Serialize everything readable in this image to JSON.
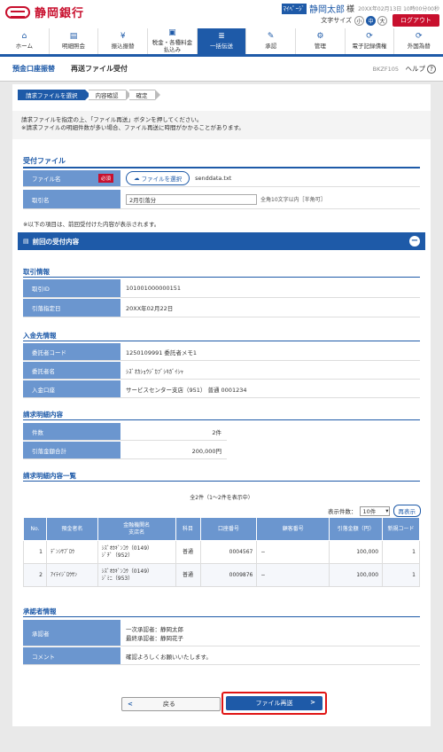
{
  "header": {
    "bank_name": "静岡銀行",
    "user_badge": "ﾏｲﾍﾟｰｼﾞ",
    "user_name": "静岡太郎",
    "user_suffix": "様",
    "last_login": "20XX年02月13日 10時00分00秒",
    "font_size_label": "文字サイズ",
    "font_sizes": [
      "小",
      "中",
      "大"
    ],
    "logout": "ログアウト"
  },
  "nav": [
    {
      "icon": "home-icon",
      "glyph": "⌂",
      "label": "ホーム"
    },
    {
      "icon": "statement-icon",
      "glyph": "▤",
      "label": "明細照会"
    },
    {
      "icon": "transfer-icon",
      "glyph": "¥",
      "label": "振込振替"
    },
    {
      "icon": "tax-icon",
      "glyph": "▣",
      "label": "税金・各種料金\n払込み"
    },
    {
      "icon": "bulk-icon",
      "glyph": "≣",
      "label": "一括伝送"
    },
    {
      "icon": "approval-icon",
      "glyph": "✎",
      "label": "承認"
    },
    {
      "icon": "admin-icon",
      "glyph": "⚙",
      "label": "管理"
    },
    {
      "icon": "e-record-icon",
      "glyph": "⟳",
      "label": "電子記録債権"
    },
    {
      "icon": "forex-icon",
      "glyph": "⟳",
      "label": "外国為替"
    }
  ],
  "title": {
    "category": "預金口座振替",
    "main": "再送ファイル受付",
    "screen_id": "BKZF105",
    "help": "ヘルプ"
  },
  "steps": [
    "請求ファイルを選択",
    "内容確認",
    "確定"
  ],
  "notice": {
    "line1": "請求ファイルを指定の上、「ファイル再送」ボタンを押してください。",
    "line2": "※請求ファイルの明細件数が多い場合、ファイル再送に時間がかかることがあります。"
  },
  "upload": {
    "section": "受付ファイル",
    "file_label": "ファイル名",
    "required": "必須",
    "choose_btn": "ファイルを選択",
    "file_name": "senddata.txt",
    "name_label": "取引名",
    "name_value": "2月引落分",
    "name_note": "全角10文字以内［半角可］"
  },
  "note_below": "※以下の項目は、前回受付けた内容が表示されます。",
  "prev": {
    "head": "前回の受付内容",
    "toggle": "−",
    "trade": {
      "title": "取引情報",
      "rows": [
        {
          "label": "取引ID",
          "value": "101001000000151"
        },
        {
          "label": "引落指定日",
          "value": "20XX年02月22日"
        }
      ]
    },
    "deposit": {
      "title": "入金先情報",
      "rows": [
        {
          "label": "委託者コード",
          "value": "1250109991 委託者メモ1"
        },
        {
          "label": "委託者名",
          "value": "ｼｽﾞｵｶｼｮｳｼﾞｶﾌﾞｼｷｶﾞｲｼｬ"
        },
        {
          "label": "入金口座",
          "value": "サービスセンター支店（951） 普通 0001234"
        }
      ]
    },
    "billing": {
      "title": "請求明細内容",
      "rows": [
        {
          "label": "件数",
          "value": "2件"
        },
        {
          "label": "引落金額合計",
          "value": "200,000円"
        }
      ]
    },
    "list": {
      "title": "請求明細内容一覧",
      "count_text": "全2件（1～2件を表示中）",
      "per_page_label": "表示件数：",
      "per_page_value": "10件",
      "redisplay": "再表示",
      "columns": [
        "No.",
        "預金者名",
        "金融機関名\n支店名",
        "科目",
        "口座番号",
        "顧客番号",
        "引落金額（円）",
        "新規コード"
      ],
      "rows": [
        {
          "no": "1",
          "name": "ﾃﾞﾝｼｻﾌﾞﾛｳ",
          "bank": "ｼｽﾞｵｶｷﾞﾝｺｳ（0149）",
          "branch": "ｼﾞﾁﾞ（952）",
          "type": "普通",
          "account": "0004567",
          "customer": "−",
          "amount": "100,000",
          "code": "1"
        },
        {
          "no": "2",
          "name": "ｱｲﾃｲｼﾞﾛｳｻﾝ",
          "bank": "ｼｽﾞｵｶｷﾞﾝｺｳ（0149）",
          "branch": "ｼﾞﾐﾆ（953）",
          "type": "普通",
          "account": "0009876",
          "customer": "−",
          "amount": "100,000",
          "code": "1"
        }
      ]
    },
    "approver": {
      "title": "承認者情報",
      "approver_label": "承認者",
      "approver1": "一次承認者：静岡太郎",
      "approver2": "最終承認者：静岡花子",
      "comment_label": "コメント",
      "comment": "確認よろしくお願いいたします。"
    }
  },
  "buttons": {
    "back": "戻る",
    "resend": "ファイル再送"
  }
}
